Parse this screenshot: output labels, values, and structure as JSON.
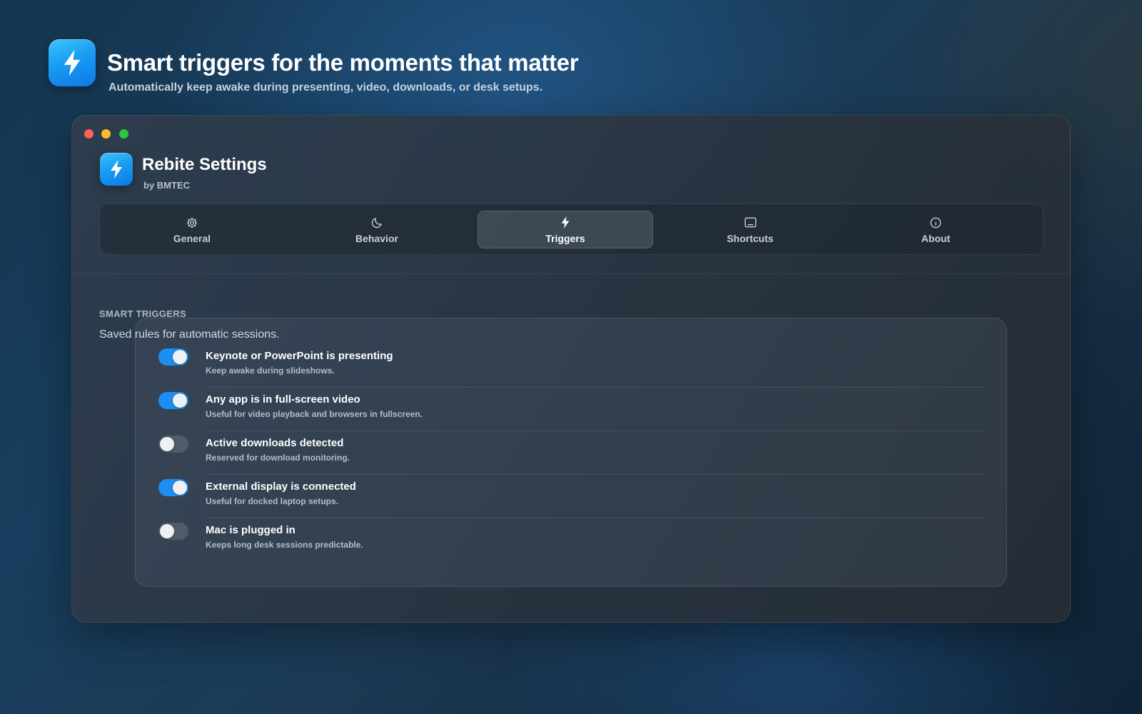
{
  "hero": {
    "title": "Smart triggers for the moments that matter",
    "subtitle": "Automatically keep awake during presenting, video, downloads, or desk setups.",
    "icon": "bolt-icon"
  },
  "window": {
    "title": "Rebite Settings",
    "byline": "by BMTEC",
    "traffic_colors": [
      "#ff5f57",
      "#febc2e",
      "#28c840"
    ]
  },
  "tabs": [
    {
      "label": "General",
      "icon": "gear-icon"
    },
    {
      "label": "Behavior",
      "icon": "moon-icon"
    },
    {
      "label": "Triggers",
      "icon": "bolt-icon",
      "active": true
    },
    {
      "label": "Shortcuts",
      "icon": "keyboard-icon"
    },
    {
      "label": "About",
      "icon": "info-icon"
    }
  ],
  "section": {
    "title": "SMART TRIGGERS",
    "description": "Saved rules for automatic sessions."
  },
  "triggers": [
    {
      "title": "Keynote or PowerPoint is presenting",
      "subtitle": "Keep awake during slideshows.",
      "enabled": true
    },
    {
      "title": "Any app is in full-screen video",
      "subtitle": "Useful for video playback and browsers in fullscreen.",
      "enabled": true
    },
    {
      "title": "Active downloads detected",
      "subtitle": "Reserved for download monitoring.",
      "enabled": false
    },
    {
      "title": "External display is connected",
      "subtitle": "Useful for docked laptop setups.",
      "enabled": true
    },
    {
      "title": "Mac is plugged in",
      "subtitle": "Keeps long desk sessions predictable.",
      "enabled": false
    }
  ],
  "colors": {
    "accent": "#1d8ff2",
    "icon_gradient_top": "#3cc4ff",
    "icon_gradient_bottom": "#0b78e6"
  }
}
